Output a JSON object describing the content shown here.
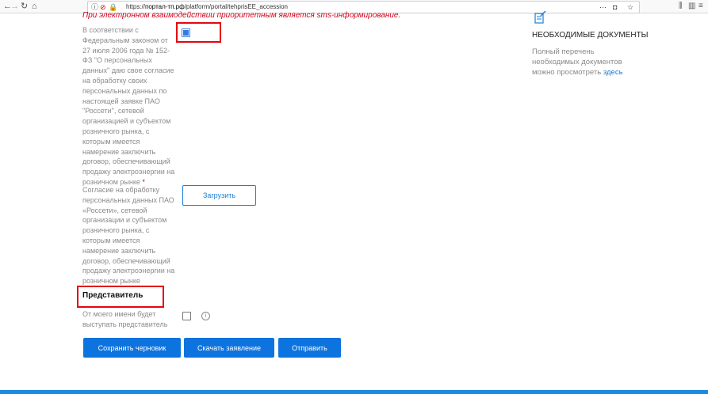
{
  "browser": {
    "url_prefix": "https://",
    "url_domain": "портал-тп.рф",
    "url_path": "/platform/portal/tehprisEE_accession"
  },
  "form": {
    "warning_text": "При электронном взаимодействии приоритетным является sms-информирование.",
    "consent_label": "В соответствии с Федеральным законом от 27 июля 2006 года № 152-ФЗ \"О персональных данных\" даю свое согласие на обработку своих персональных данных по настоящей заявке ПАО \"Россети\", сетевой организацией и субъектом розничного рынка, с которым имеется намерение заключить договор, обеспечивающий продажу электроэнергии на розничном рынке",
    "required_mark": "*",
    "consent_checked": true,
    "upload_label": "Согласие на обработку персональных данных ПАО «Россети», сетевой организации и субъектом розничного рынка, с которым имеется намерение заключить договор, обеспечивающий продажу электроэнергии на розничном рынке",
    "upload_button": "Загрузить",
    "representative_title": "Представитель",
    "representative_label": "От моего имени будет выступать представитель",
    "representative_checked": false,
    "info_glyph": "i",
    "buttons": {
      "save_draft": "Сохранить черновик",
      "download": "Скачать заявление",
      "submit": "Отправить"
    }
  },
  "sidebar": {
    "docs_title": "НЕОБХОДИМЫЕ ДОКУМЕНТЫ",
    "docs_text": "Полный перечень необходимых документов можно просмотреть",
    "docs_link": "здесь"
  },
  "colors": {
    "accent": "#0d74df",
    "highlight": "#e30613",
    "warning": "#d0021b"
  }
}
